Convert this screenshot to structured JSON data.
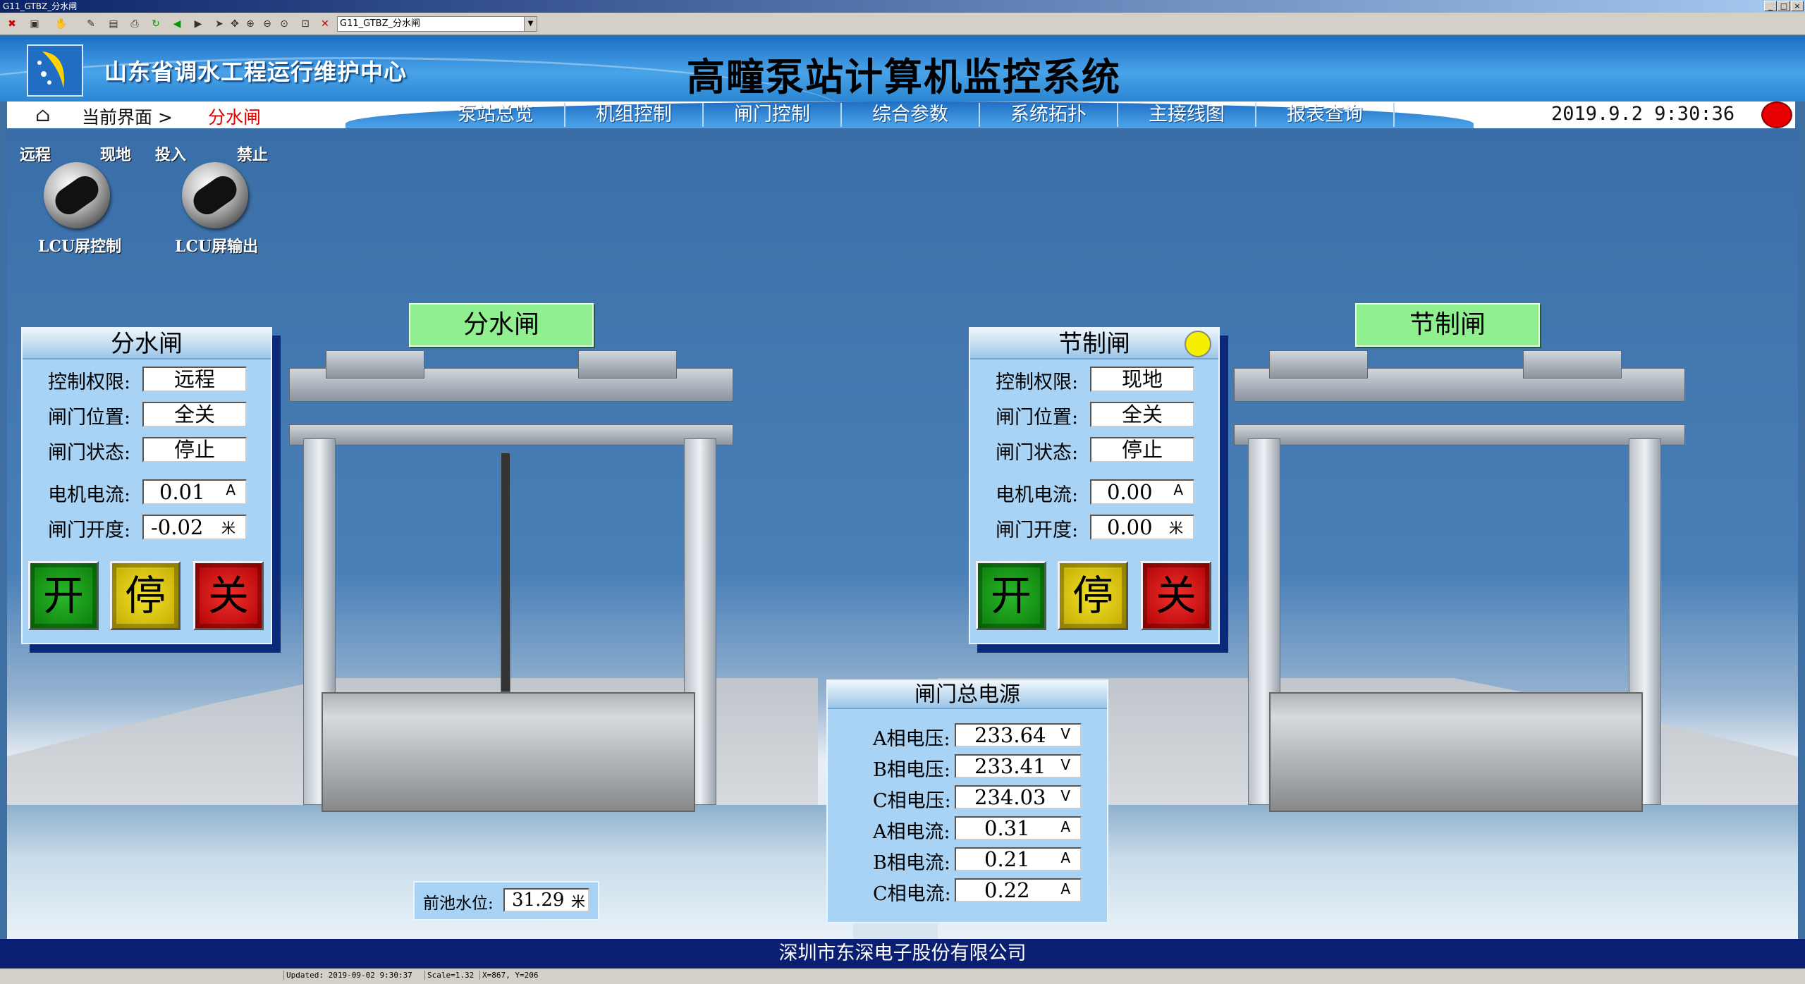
{
  "window": {
    "title": "G11_GTBZ_分水闸"
  },
  "toolbar": {
    "page_select_value": "G11_GTBZ_分水闸"
  },
  "header": {
    "org_name": "山东省调水工程运行维护中心",
    "system_title": "高疃泵站计算机监控系统"
  },
  "nav": {
    "current_label": "当前界面 >",
    "current_page": "分水闸",
    "items": [
      "泵站总览",
      "机组控制",
      "闸门控制",
      "综合参数",
      "系统拓扑",
      "主接线图",
      "报表查询"
    ],
    "datetime": "2019.9.2   9:30:36"
  },
  "switches": {
    "lcu_control": {
      "left": "远程",
      "right": "现地",
      "label": "LCU屏控制"
    },
    "lcu_output": {
      "left": "投入",
      "right": "禁止",
      "label": "LCU屏输出"
    }
  },
  "gate_left": {
    "tag": "分水闸",
    "panel_title": "分水闸",
    "labels": {
      "control": "控制权限:",
      "position": "闸门位置:",
      "state": "闸门状态:",
      "current": "电机电流:",
      "opening": "闸门开度:"
    },
    "values": {
      "control": "远程",
      "position": "全关",
      "state": "停止",
      "current": "0.01",
      "current_unit": "A",
      "opening": "-0.02",
      "opening_unit": "米"
    },
    "buttons": {
      "open": "开",
      "stop": "停",
      "close": "关"
    }
  },
  "gate_right": {
    "tag": "节制闸",
    "panel_title": "节制闸",
    "labels": {
      "control": "控制权限:",
      "position": "闸门位置:",
      "state": "闸门状态:",
      "current": "电机电流:",
      "opening": "闸门开度:"
    },
    "values": {
      "control": "现地",
      "position": "全关",
      "state": "停止",
      "current": "0.00",
      "current_unit": "A",
      "opening": "0.00",
      "opening_unit": "米"
    },
    "buttons": {
      "open": "开",
      "stop": "停",
      "close": "关"
    },
    "status_color": "#f4f000"
  },
  "forebay": {
    "label": "前池水位:",
    "value": "31.29",
    "unit": "米"
  },
  "power": {
    "title": "闸门总电源",
    "rows": [
      {
        "label": "A相电压:",
        "value": "233.64",
        "unit": "V"
      },
      {
        "label": "B相电压:",
        "value": "233.41",
        "unit": "V"
      },
      {
        "label": "C相电压:",
        "value": "234.03",
        "unit": "V"
      },
      {
        "label": "A相电流:",
        "value": "0.31",
        "unit": "A"
      },
      {
        "label": "B相电流:",
        "value": "0.21",
        "unit": "A"
      },
      {
        "label": "C相电流:",
        "value": "0.22",
        "unit": "A"
      }
    ]
  },
  "footer": {
    "company": "深圳市东深电子股份有限公司"
  },
  "statusbar": {
    "updated": "Updated: 2019-09-02 9:30:37",
    "scale": "Scale=1.32",
    "coords": "X=867, Y=206"
  },
  "colors": {
    "alarm": "#e80000",
    "current_page": "#e00000",
    "panel_bg": "#a9d3f4",
    "footer_bg": "#0a1e72"
  }
}
